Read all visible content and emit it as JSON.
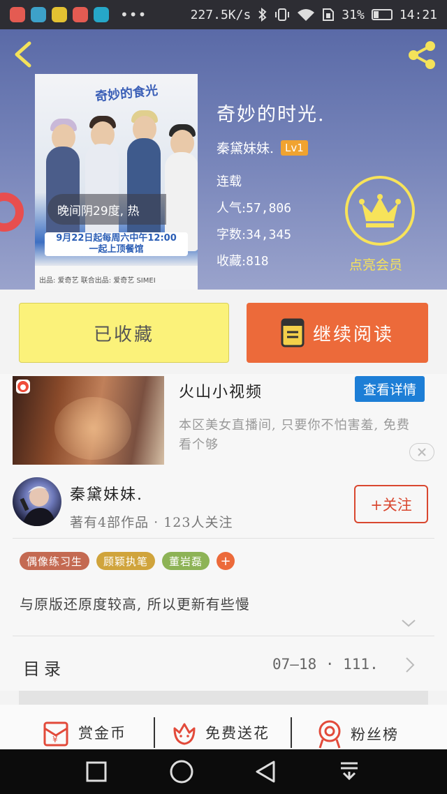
{
  "status_bar": {
    "net_speed": "227.5K/s",
    "battery": "31%",
    "battery_level": 0.31,
    "time": "14:21"
  },
  "book": {
    "title": "奇妙的时光.",
    "author": "秦黛妹妹.",
    "level": "Lv1",
    "status": "连载",
    "popularity_label": "人气:",
    "popularity": "57,806",
    "words_label": "字数:",
    "words": "34,345",
    "favorites_label": "收藏:",
    "favorites": "818",
    "cover_overlay_text": "晚间阴29度, 热",
    "cover_date_text": "9月22日起每周六中午12:00",
    "cover_date_sub": "一起上顶餐馆",
    "cover_logo": "奇妙的食光",
    "cover_bottom_text": "出品: 爱奇艺   联合出品: 爱奇艺   SIMEI"
  },
  "vip": {
    "label": "点亮会员"
  },
  "actions": {
    "collected_label": "已收藏",
    "continue_label": "继续阅读"
  },
  "ad": {
    "title": "火山小视频",
    "detail_label": "查看详情",
    "description": "本区美女直播间, 只要你不怕害羞, 免费看个够"
  },
  "author_card": {
    "name": "秦黛妹妹.",
    "works": "著有4部作品 · 123人关注",
    "follow_label": "+关注"
  },
  "tags": [
    {
      "label": "偶像练习生",
      "color": "#c46a52"
    },
    {
      "label": "顾颖执笔",
      "color": "#d0a43c"
    },
    {
      "label": "董岩磊",
      "color": "#8db356"
    }
  ],
  "tag_add_label": "+",
  "intro": "与原版还原度较高, 所以更新有些慢",
  "toc": {
    "label": "目录",
    "meta": "07—18 · 111."
  },
  "bottom_actions": {
    "coin": "赏金币",
    "flower": "免费送花",
    "fans": "粉丝榜"
  },
  "colors": {
    "accent_orange": "#ec6a3a",
    "collected_yellow": "#fbf27a",
    "vip_gold": "#f7e35a",
    "follow_red": "#d9472f",
    "detail_blue": "#1d7ed6"
  }
}
